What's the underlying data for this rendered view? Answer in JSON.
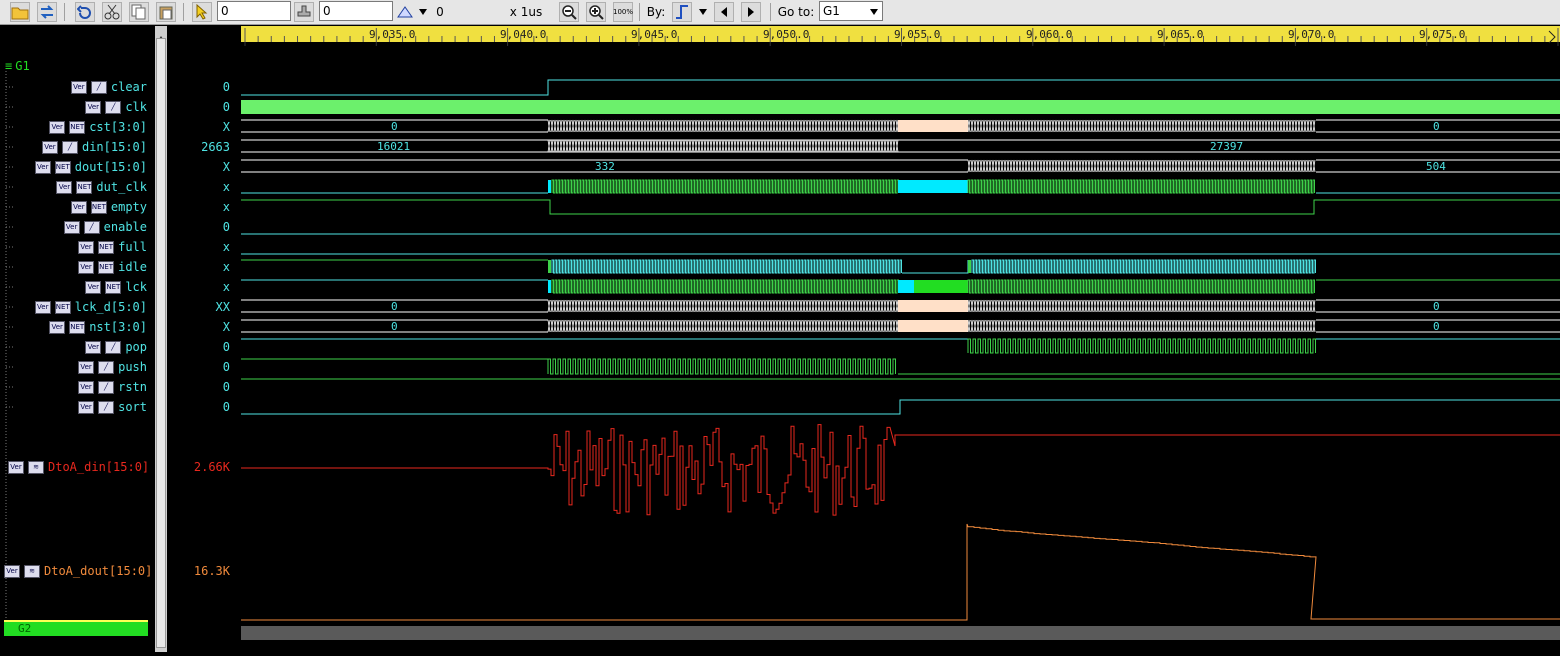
{
  "toolbar": {
    "field1_value": "0",
    "field2_value": "0",
    "zoom_value": "0",
    "unit_label": "x 1us",
    "by_label": "By:",
    "goto_label": "Go to:",
    "goto_value": "G1",
    "zoom_100_label": "100%"
  },
  "groups": {
    "g1": "G1",
    "g2": "G2"
  },
  "signals": [
    {
      "name": "clear",
      "value": "0"
    },
    {
      "name": "clk",
      "value": "0"
    },
    {
      "name": "cst[3:0]",
      "value": "X"
    },
    {
      "name": "din[15:0]",
      "value": "2663"
    },
    {
      "name": "dout[15:0]",
      "value": "X"
    },
    {
      "name": "dut_clk",
      "value": "x"
    },
    {
      "name": "empty",
      "value": "x"
    },
    {
      "name": "enable",
      "value": "0"
    },
    {
      "name": "full",
      "value": "x"
    },
    {
      "name": "idle",
      "value": "x"
    },
    {
      "name": "lck",
      "value": "x"
    },
    {
      "name": "lck_d[5:0]",
      "value": "XX"
    },
    {
      "name": "nst[3:0]",
      "value": "X"
    },
    {
      "name": "pop",
      "value": "0"
    },
    {
      "name": "push",
      "value": "0"
    },
    {
      "name": "rstn",
      "value": "0"
    },
    {
      "name": "sort",
      "value": "0"
    }
  ],
  "analog": [
    {
      "name": "DtoA_din[15:0]",
      "value": "2.66K"
    },
    {
      "name": "DtoA_dout[15:0]",
      "value": "16.3K"
    }
  ],
  "ruler": [
    "9,035.0",
    "9,040.0",
    "9,045.0",
    "9,050.0",
    "9,055.0",
    "9,060.0",
    "9,065.0",
    "9,070.0",
    "9,075.0"
  ],
  "bus_labels": {
    "cst_left": "0",
    "cst_right": "0",
    "din_left": "16021",
    "din_right": "27397",
    "dout_left": "332",
    "dout_right": "504",
    "lckd_left": "0",
    "lckd_right": "0",
    "nst_left": "0",
    "nst_right": "0"
  },
  "icon_text": {
    "ver": "Ver",
    "net": "NET"
  },
  "colors": {
    "toolbar_bg": "#e6e6e6",
    "ruler_bg": "#f0e040",
    "wave_cyan": "#4fe3e3",
    "wave_green": "#3ed24a",
    "clk_fill": "#6cf06c",
    "peach": "#ffe0c8",
    "analog_red": "#e8281e",
    "analog_orange": "#f08a3c",
    "group_green": "#22dd22"
  }
}
